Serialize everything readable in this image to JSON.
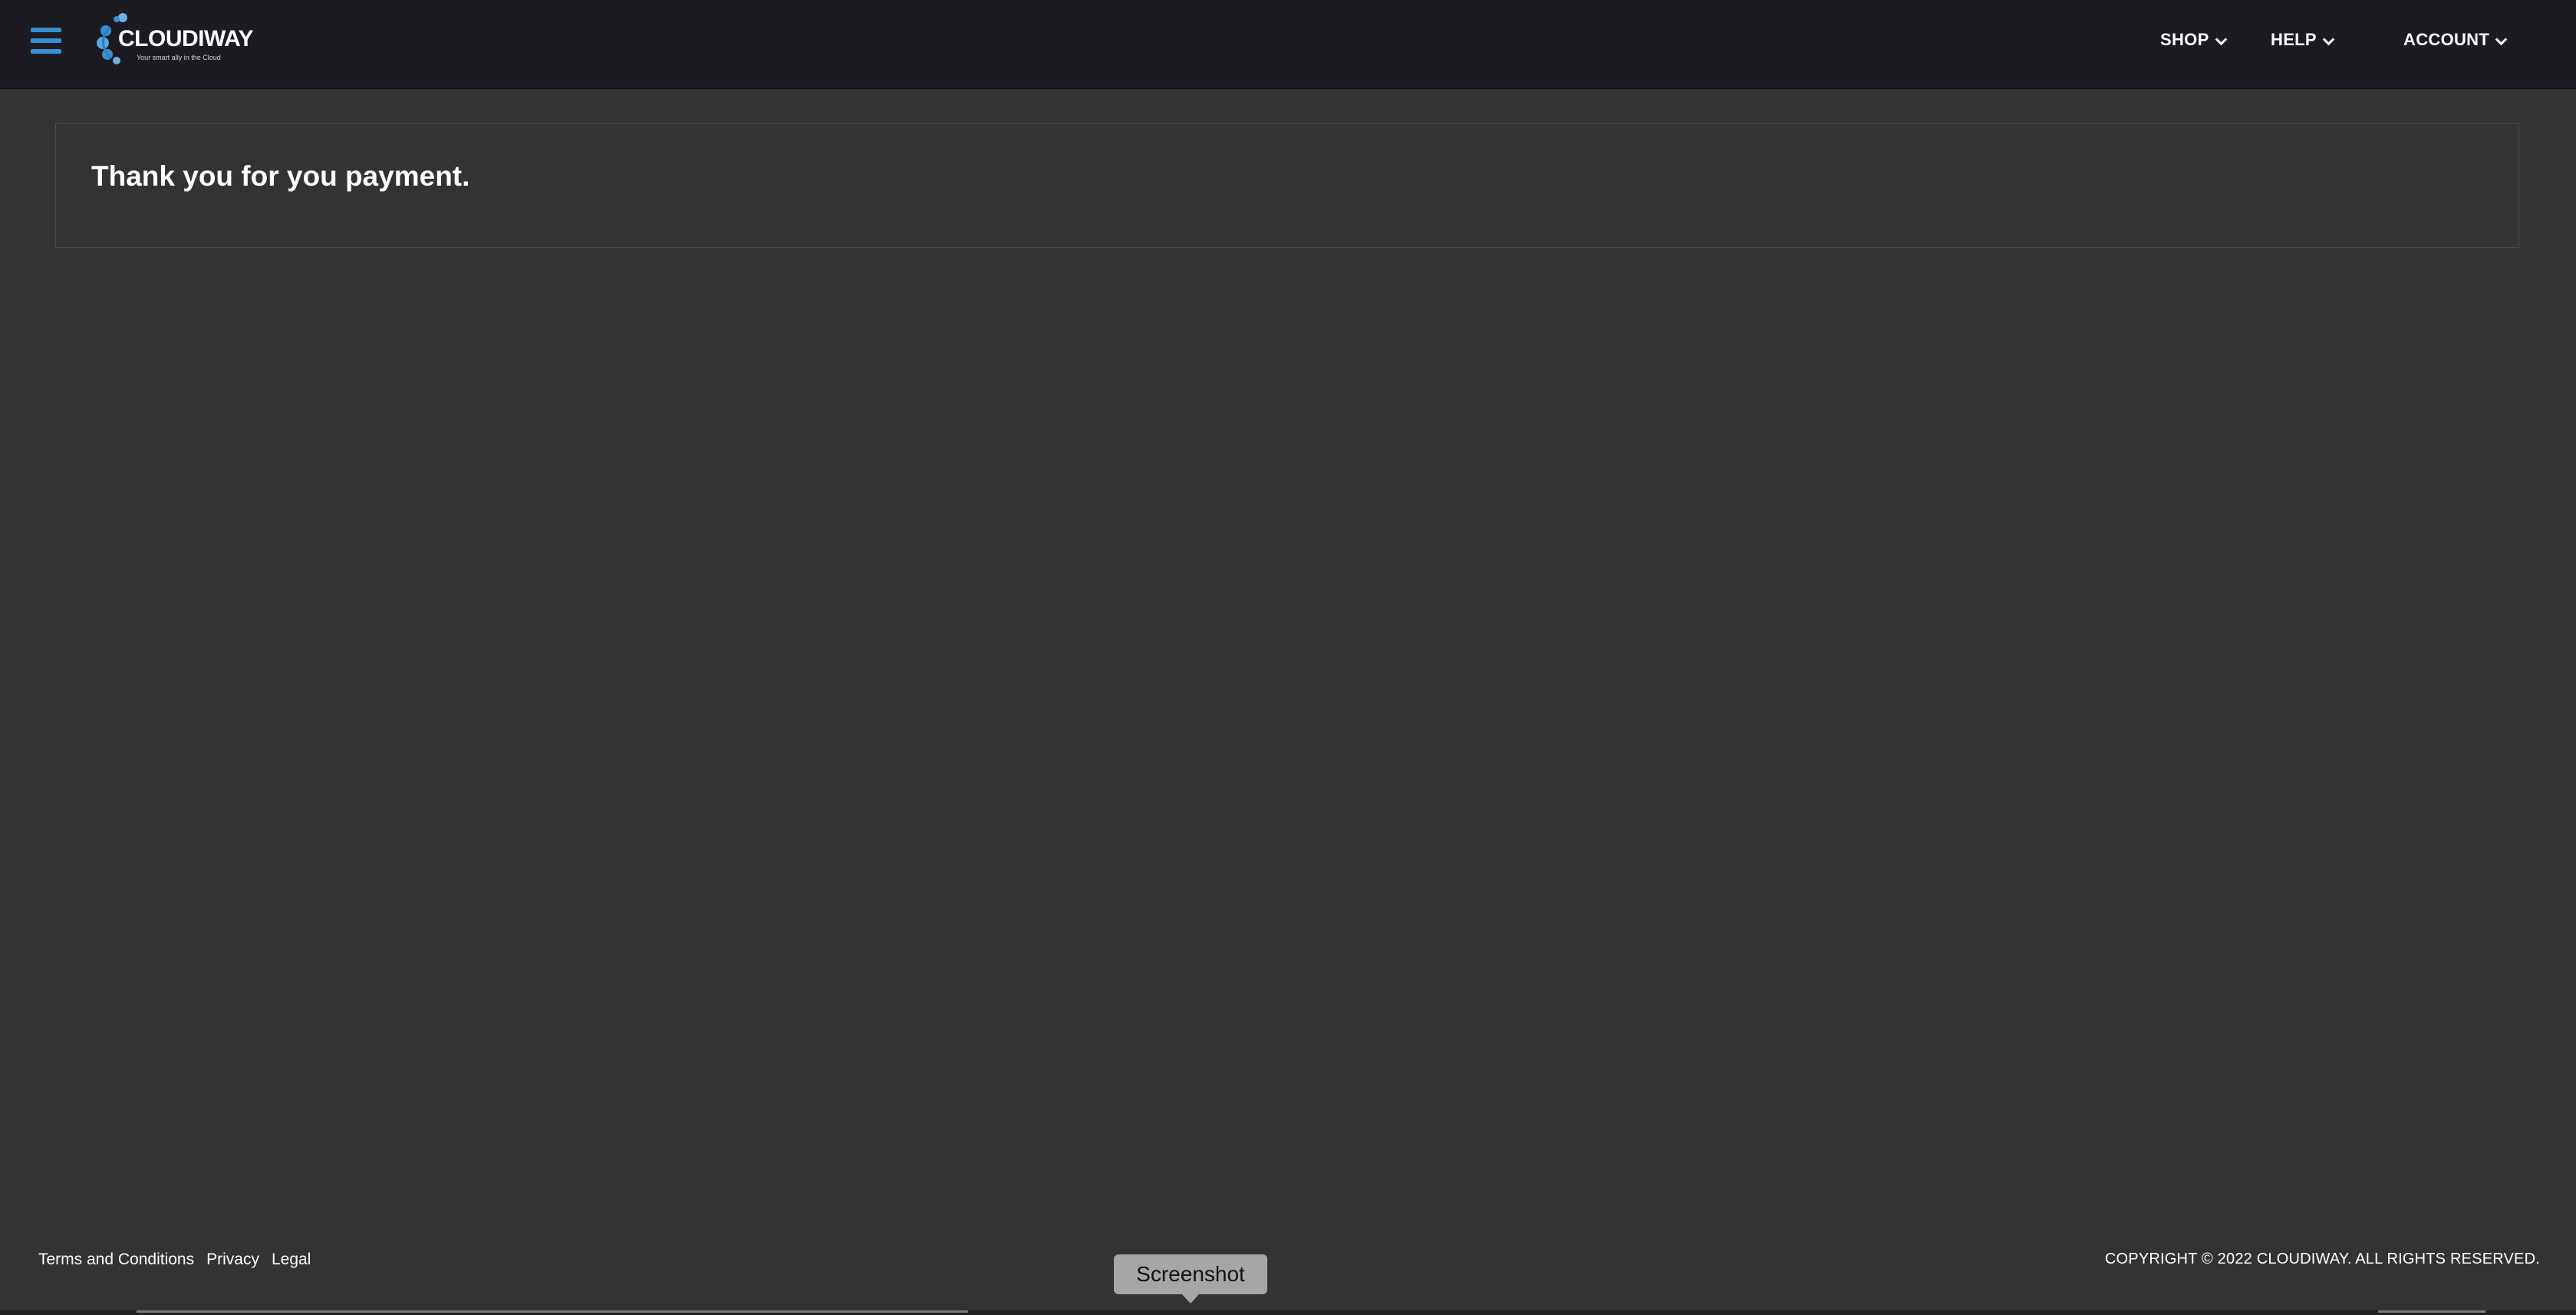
{
  "header": {
    "logo_text": "CLOUDIWAY",
    "logo_tagline": "Your smart ally in the Cloud",
    "nav": [
      {
        "label": "SHOP"
      },
      {
        "label": "HELP"
      },
      {
        "label": "ACCOUNT"
      }
    ]
  },
  "main": {
    "message": "Thank you for you payment."
  },
  "footer": {
    "links": [
      "Terms and Conditions",
      "Privacy",
      "Legal"
    ],
    "copyright": "COPYRIGHT © 2022 CLOUDIWAY. ALL RIGHTS RESERVED."
  },
  "overlay": {
    "tooltip": "Screenshot"
  },
  "colors": {
    "background": "#333333",
    "topbar": "#1c1b21",
    "accent": "#3a8fd0"
  }
}
